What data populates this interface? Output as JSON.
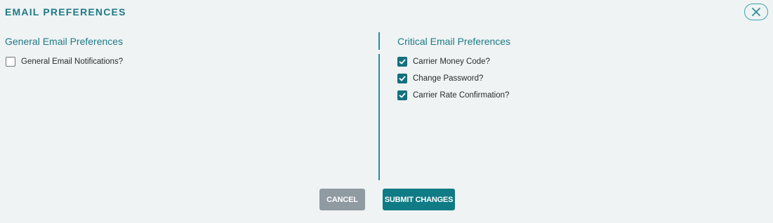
{
  "modal": {
    "title": "EMAIL PREFERENCES",
    "close_icon": "close-icon"
  },
  "general": {
    "heading": "General Email Preferences",
    "options": [
      {
        "label": "General Email Notifications?",
        "checked": false
      }
    ]
  },
  "critical": {
    "heading": "Critical Email Preferences",
    "options": [
      {
        "label": "Carrier Money Code?",
        "checked": true
      },
      {
        "label": "Change Password?",
        "checked": true
      },
      {
        "label": "Carrier Rate Confirmation?",
        "checked": true
      }
    ]
  },
  "buttons": {
    "cancel_label": "CANCEL",
    "submit_label": "SUBMIT CHANGES"
  },
  "colors": {
    "accent": "#1f7a86",
    "checkbox_checked": "#14707c",
    "cancel_bg": "#8f9aa1",
    "submit_bg": "#0f7b85",
    "background": "#eff3f4"
  }
}
